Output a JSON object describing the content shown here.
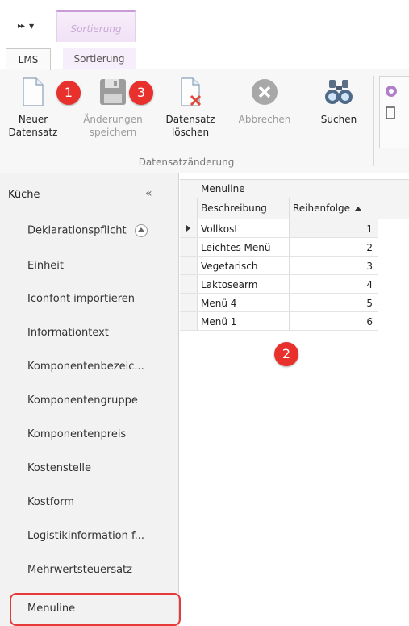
{
  "qat": {
    "context_tab": "Sortierung"
  },
  "tabs": [
    {
      "label": "LMS"
    },
    {
      "label": "Sortierung"
    }
  ],
  "ribbon": {
    "buttons": [
      {
        "label1": "Neuer",
        "label2": "Datensatz",
        "icon": "new-document-icon"
      },
      {
        "label1": "Änderungen",
        "label2": "speichern",
        "icon": "save-disk-icon"
      },
      {
        "label1": "Datensatz",
        "label2": "löschen",
        "icon": "delete-document-icon"
      },
      {
        "label1": "Abbrechen",
        "label2": "",
        "icon": "cancel-icon"
      },
      {
        "label1": "Suchen",
        "label2": "",
        "icon": "binoculars-icon"
      }
    ],
    "group_label": "Datensatzänderung"
  },
  "badges": {
    "b1": "1",
    "b2": "2",
    "b3": "3",
    "color": "#e8302c"
  },
  "nav": {
    "header": "Küche",
    "collapse": "«",
    "items": [
      "Deklarationspflicht",
      "Einheit",
      "Iconfont importieren",
      "Informationtext",
      "Komponentenbezeic...",
      "Komponentengruppe",
      "Komponentenpreis",
      "Kostenstelle",
      "Kostform",
      "Logistikinformation f...",
      "Mehrwertsteuersatz",
      "Menuline"
    ]
  },
  "grid": {
    "group_title": "Menuline",
    "columns": [
      "Beschreibung",
      "Reihenfolge"
    ],
    "rows": [
      {
        "b": "Vollkost",
        "r": "1"
      },
      {
        "b": "Leichtes Menü",
        "r": "2"
      },
      {
        "b": "Vegetarisch",
        "r": "3"
      },
      {
        "b": "Laktosearm",
        "r": "4"
      },
      {
        "b": "Menü 4",
        "r": "5"
      },
      {
        "b": "Menü 1",
        "r": "6"
      }
    ]
  }
}
